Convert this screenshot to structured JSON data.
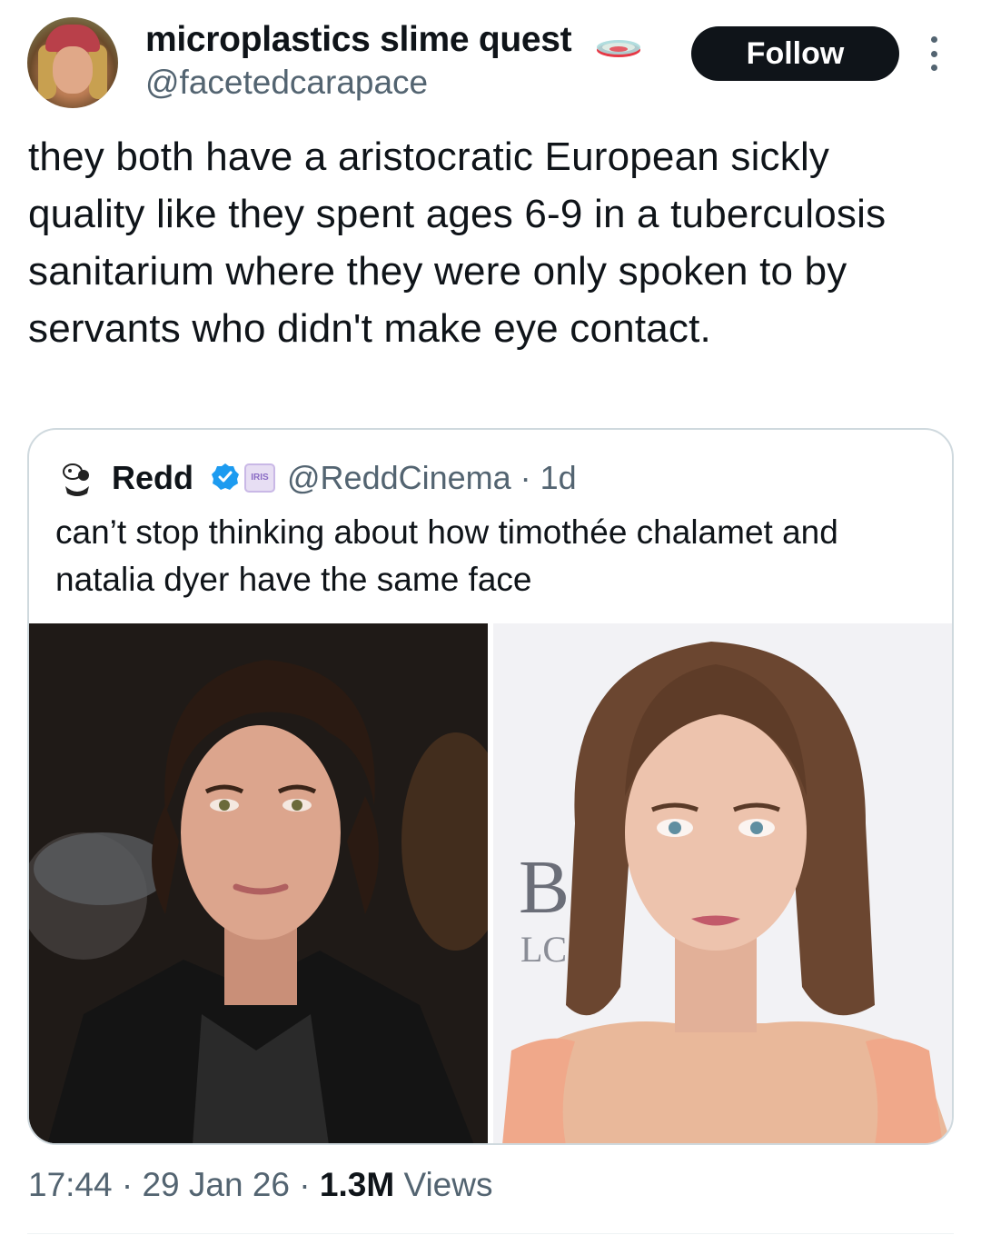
{
  "author": {
    "display_name": "microplastics slime quest",
    "handle": "@facetedcarapace",
    "name_emoji": "petri-dish-emoji"
  },
  "follow_label": "Follow",
  "tweet_text": "they both have a aristocratic European sickly quality like they spent ages 6-9 in a tuberculosis sanitarium where they were only spoken to by servants who didn't make eye contact.",
  "quoted": {
    "name": "Redd",
    "verified_icon": "verified-badge-icon",
    "affiliate_badge": "IRIS",
    "meta": "@ReddCinema · 1d",
    "text": "can’t stop thinking about how timothée chalamet and natalia dyer have the same face",
    "images": [
      {
        "alt": "photo-man-dark-hair-black-jacket"
      },
      {
        "alt": "photo-woman-bob-hair-peach-top"
      }
    ],
    "backdrop_text": [
      "B",
      "LC"
    ]
  },
  "footer": {
    "time": "17:44",
    "sep1": " · ",
    "date": "29 Jan 26",
    "sep2": " · ",
    "views_count": "1.3M",
    "views_label": " Views"
  },
  "colors": {
    "text": "#0f1419",
    "secondary": "#536471",
    "border": "#cfd9de",
    "verified": "#1d9bf0",
    "follow_bg": "#0f1419"
  }
}
